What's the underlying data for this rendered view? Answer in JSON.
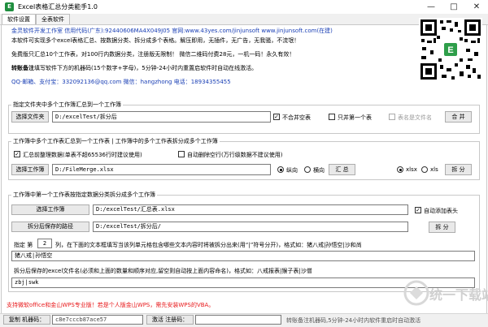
{
  "window": {
    "title": "Excel表格汇总分类能手1.0",
    "app_icon": "excel-green-icon",
    "minimize": "—",
    "maximize": "□",
    "close": "✕"
  },
  "tabs": [
    "软件设置",
    "全表软件"
  ],
  "header": {
    "company_line": "金灵软件开发工作室  信用代码(广东):92440606MA4X049J05  官网:www.43yes.com/jinjunsoft  www.jinjunsoft.com(在建)",
    "desc_line": "本软件可实现多个excel表格汇总、按数据分类、拆分成多个表格。解压即用，无插件，无广告，无我骚，不流氓！",
    "free_line": "免费版只汇总10个工作表，对100行内数据分类，注册版无限制！ 微信二维码付费28元，一机一码！永久有效！",
    "register_prefix": "转账备注",
    "register_line": "填写软件下方的机器码(15个数字+字母)，5分钟-24小时内重置启软件时自动在线激活。",
    "contact_line": "QQ·邮箱、支付宝：332092136@qq.com     微信：hangzhong     电话：18934355455",
    "qr_logo": "excel-logo-icon"
  },
  "section1": {
    "title": "指定文件夹中多个工作簿汇总到一个工作簿",
    "select_folder_btn": "选择文件夹",
    "folder_path": "D:/excelTest/拆分后",
    "skip_empty_label": "不合并空表",
    "skip_empty_checked": true,
    "only_first_label": "只并第一个表",
    "only_first_checked": false,
    "sheet_as_filename_label": "表名是文件名",
    "sheet_as_filename_checked": false,
    "merge_btn": "合 并"
  },
  "section2": {
    "title": "工作簿中多个工作表汇总到一个工作表 | 工作簿中的多个工作表拆分成多个工作簿",
    "summarize_data_label": "汇总前整理数据(单表不超65536行时建议使用)",
    "summarize_data_checked": true,
    "auto_delete_label": "自动删除空行(万行级数据不建议使用)",
    "auto_delete_checked": false,
    "select_workbook_btn": "选择工作簿",
    "workbook_path": "D:/FileMerge.xlsx",
    "vertical_label": "纵向",
    "vertical_selected": true,
    "horizontal_label": "横向",
    "horizontal_selected": false,
    "summary_btn": "汇 总",
    "xlsx_label": "xlsx",
    "xlsx_selected": true,
    "xls_label": "xls",
    "xls_selected": false,
    "split_btn": "拆 分"
  },
  "section3": {
    "title": "工作簿中第一个工作表按指定数据分类拆分成多个工作簿",
    "select_workbook_btn": "选择工作簿",
    "workbook_path": "D:/excelTest/汇总表.xlsx",
    "auto_header_label": "自动添加表头",
    "auto_header_checked": true,
    "save_path_btn": "拆分后保存的路径",
    "save_path": "D:/excelTest/拆分后/",
    "split_btn": "拆 分",
    "specify_prefix": "指定 第",
    "column_number": "2",
    "specify_suffix": "列，在下面的文本框填写当该列单元格包含哪些文本内容时将被拆分出来(用“|”符号分开)，格式如：猪八戒|孙悟空|沙和尚",
    "keywords_value": "猪八戒|孙悟空",
    "filename_hint": "拆分后保存的excel文件名(必须和上面的数量和顺序对应,留空则自动按上面内容命名)，格式如：八戒报表|猴子表|沙僧",
    "filenames_value": "zbj|swk"
  },
  "footer": {
    "wps_note": "支持微软office和金山WPS专业版！若是个人版金山WPS，需先安装WPS的VBA。",
    "copy_code_btn": "复制 机器码：",
    "machine_code": "c8e7cccb87ace57",
    "activate_btn": "激活 注册码：",
    "register_code": "",
    "status_text": "转账备注机器码,5分钟-24小时内软件重启时自动激活"
  },
  "watermark": {
    "text": "统一下载站",
    "logo": "watermark-logo-icon"
  }
}
